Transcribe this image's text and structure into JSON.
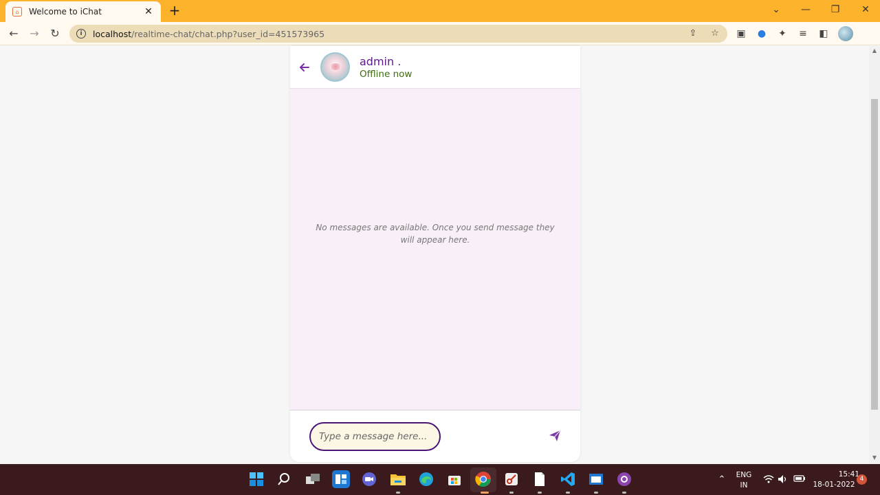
{
  "browser": {
    "tab_title": "Welcome to iChat",
    "tab_close": "✕",
    "new_tab": "+",
    "url_host": "localhost",
    "url_path": "/realtime-chat/chat.php?user_id=451573965",
    "window_controls": {
      "chevron": "⌄",
      "minimize": "—",
      "restore": "❐",
      "close": "✕"
    },
    "nav": {
      "back": "←",
      "forward": "→",
      "reload": "↻"
    }
  },
  "chat": {
    "user_name": "admin .",
    "status": "Offline now",
    "empty_message": "No messages are available. Once you send message they will appear here.",
    "input_placeholder": "Type a message here...",
    "input_value": "",
    "accent_color": "#5b1a86",
    "status_color": "#3d6b12",
    "chat_bg": "#f9eff9"
  },
  "taskbar": {
    "lang_line1": "ENG",
    "lang_line2": "IN",
    "time": "15:41",
    "date": "18-01-2022",
    "notifications": "4"
  }
}
